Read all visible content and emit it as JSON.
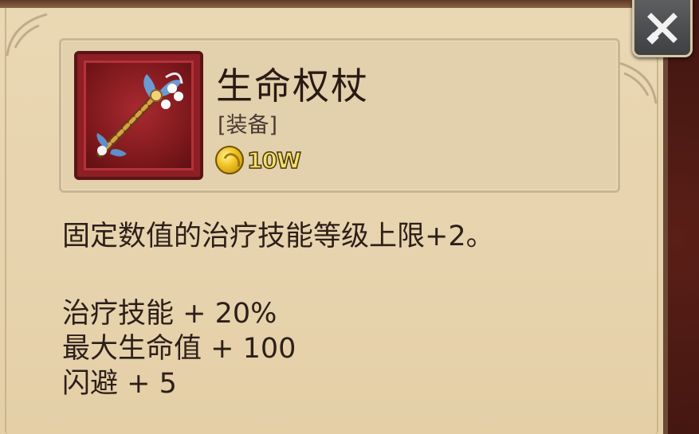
{
  "item": {
    "name": "生命权杖",
    "type": "[装备]",
    "price": "10W",
    "icon": "staff-icon",
    "frame_color": "#8e1f24"
  },
  "description": "固定数值的治疗技能等级上限+2。",
  "stats": [
    "治疗技能 + 20%",
    "最大生命值 + 100",
    "闪避 + 5"
  ],
  "close": {
    "icon": "close-icon"
  },
  "currency": {
    "icon": "gold-coin-icon"
  }
}
